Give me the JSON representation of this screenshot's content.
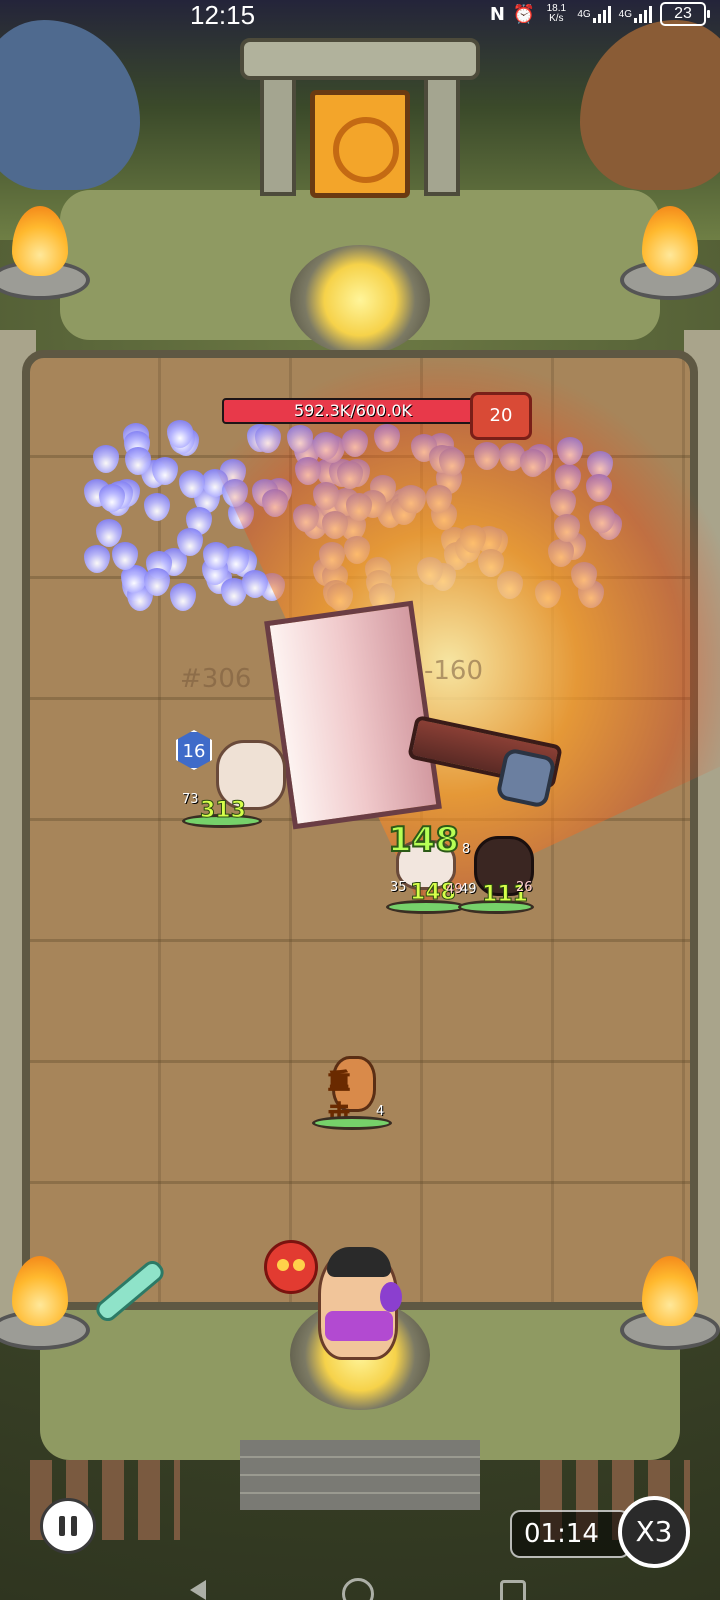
{
  "status_bar": {
    "time": "12:15",
    "net_speed": "18.1 K/s",
    "network_1": "4G",
    "network_2": "4G",
    "battery": "23",
    "icons": [
      "nfc-icon",
      "alarm-icon",
      "signal-icon",
      "signal-icon",
      "battery-icon"
    ]
  },
  "boss": {
    "hp_text": "592.3K/600.0K",
    "hp_fraction": 0.987,
    "level": "20",
    "bar_color": "#e8394a"
  },
  "combat": {
    "faded_numbers": [
      "#306",
      "-160"
    ],
    "big_damage": "148",
    "crit_label": "重击",
    "units": [
      {
        "name": "enemy-left",
        "level_badge": "16",
        "level": "73",
        "damage": "313"
      },
      {
        "name": "enemy-mid",
        "level": "35",
        "damage": "148",
        "extra": "49"
      },
      {
        "name": "enemy-right",
        "level": "49",
        "damage": "111",
        "extra": "26",
        "top_level": "8"
      },
      {
        "name": "hero-warrior",
        "level": "4"
      }
    ]
  },
  "hud": {
    "timer": "01:14",
    "speed": "X3"
  },
  "colors": {
    "arena": "#a7855a",
    "hp_green": "#76d16a",
    "wisp": "#6b68ee"
  }
}
